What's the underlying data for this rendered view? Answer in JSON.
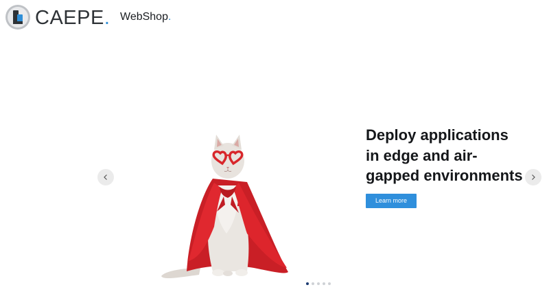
{
  "header": {
    "brand_name": "CAEPE",
    "brand_dot": ".",
    "nav_link": "WebShop",
    "nav_link_dot": "."
  },
  "carousel": {
    "headline": "Deploy applications in edge and air-gapped environments",
    "cta_label": "Learn more",
    "prev_icon": "chevron-left-icon",
    "next_icon": "chevron-right-icon",
    "slide_count": 5,
    "active_slide": 1
  },
  "colors": {
    "accent": "#2f8fdc",
    "active_dot": "#1d3c72",
    "inactive_dot": "#cfd2d6",
    "cape": "#d8262b"
  }
}
